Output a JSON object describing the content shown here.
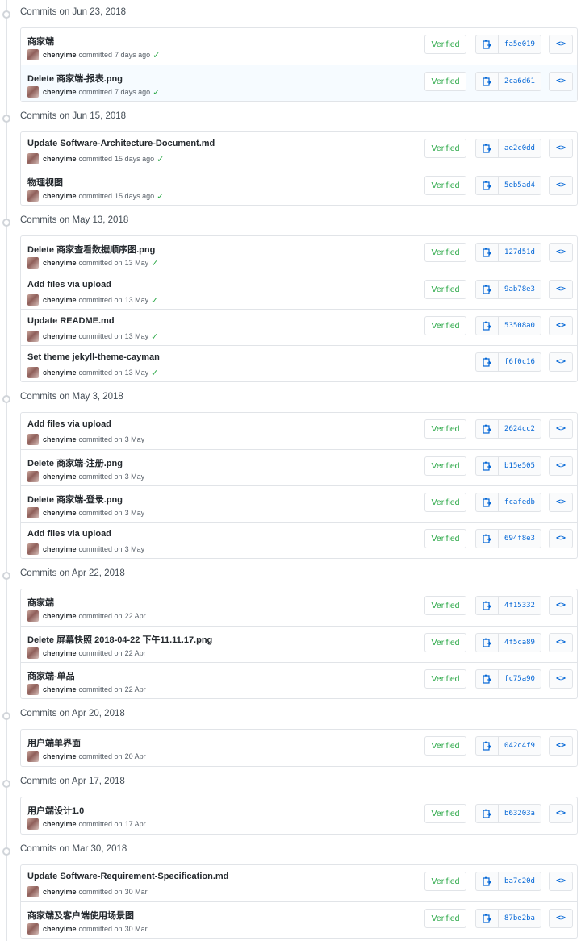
{
  "colors": {
    "verified": "#28a745",
    "sha": "#0366d6",
    "border": "#e1e4e8",
    "highlight": "#f6fbff"
  },
  "icons": {
    "copy": "clipboard-icon",
    "browse": "code-icon",
    "status": "check-icon",
    "timeline": "commit-node-icon"
  },
  "groups": [
    {
      "title": "Commits on Jun 23, 2018",
      "commits": [
        {
          "message": "商家端",
          "author": "chenyime",
          "action": "committed",
          "time": "7 days ago",
          "check": true,
          "verified": "Verified",
          "sha": "fa5e019"
        },
        {
          "message": "Delete 商家端-报表.png",
          "author": "chenyime",
          "action": "committed",
          "time": "7 days ago",
          "check": true,
          "verified": "Verified",
          "sha": "2ca6d61",
          "highlight": true
        }
      ]
    },
    {
      "title": "Commits on Jun 15, 2018",
      "commits": [
        {
          "message": "Update Software-Architecture-Document.md",
          "author": "chenyime",
          "action": "committed",
          "time": "15 days ago",
          "check": true,
          "verified": "Verified",
          "sha": "ae2c0dd"
        },
        {
          "message": "物理视图",
          "author": "chenyime",
          "action": "committed",
          "time": "15 days ago",
          "check": true,
          "verified": "Verified",
          "sha": "5eb5ad4"
        }
      ]
    },
    {
      "title": "Commits on May 13, 2018",
      "commits": [
        {
          "message": "Delete 商家查看数据顺序图.png",
          "author": "chenyime",
          "action": "committed on",
          "time": "13 May",
          "check": true,
          "verified": "Verified",
          "sha": "127d51d"
        },
        {
          "message": "Add files via upload",
          "author": "chenyime",
          "action": "committed on",
          "time": "13 May",
          "check": true,
          "verified": "Verified",
          "sha": "9ab78e3"
        },
        {
          "message": "Update README.md",
          "author": "chenyime",
          "action": "committed on",
          "time": "13 May",
          "check": true,
          "verified": "Verified",
          "sha": "53508a0"
        },
        {
          "message": "Set theme jekyll-theme-cayman",
          "author": "chenyime",
          "action": "committed on",
          "time": "13 May",
          "check": true,
          "verified": "",
          "sha": "f6f0c16"
        }
      ]
    },
    {
      "title": "Commits on May 3, 2018",
      "commits": [
        {
          "message": "Add files via upload",
          "author": "chenyime",
          "action": "committed on",
          "time": "3 May",
          "check": false,
          "verified": "Verified",
          "sha": "2624cc2"
        },
        {
          "message": "Delete 商家端-注册.png",
          "author": "chenyime",
          "action": "committed on",
          "time": "3 May",
          "check": false,
          "verified": "Verified",
          "sha": "b15e505"
        },
        {
          "message": "Delete 商家端-登录.png",
          "author": "chenyime",
          "action": "committed on",
          "time": "3 May",
          "check": false,
          "verified": "Verified",
          "sha": "fcafedb"
        },
        {
          "message": "Add files via upload",
          "author": "chenyime",
          "action": "committed on",
          "time": "3 May",
          "check": false,
          "verified": "Verified",
          "sha": "694f8e3"
        }
      ]
    },
    {
      "title": "Commits on Apr 22, 2018",
      "commits": [
        {
          "message": "商家端",
          "author": "chenyime",
          "action": "committed on",
          "time": "22 Apr",
          "check": false,
          "verified": "Verified",
          "sha": "4f15332"
        },
        {
          "message": "Delete 屏幕快照 2018-04-22 下午11.11.17.png",
          "author": "chenyime",
          "action": "committed on",
          "time": "22 Apr",
          "check": false,
          "verified": "Verified",
          "sha": "4f5ca89"
        },
        {
          "message": "商家端-单品",
          "author": "chenyime",
          "action": "committed on",
          "time": "22 Apr",
          "check": false,
          "verified": "Verified",
          "sha": "fc75a90"
        }
      ]
    },
    {
      "title": "Commits on Apr 20, 2018",
      "commits": [
        {
          "message": "用户端单界面",
          "author": "chenyime",
          "action": "committed on",
          "time": "20 Apr",
          "check": false,
          "verified": "Verified",
          "sha": "042c4f9"
        }
      ]
    },
    {
      "title": "Commits on Apr 17, 2018",
      "commits": [
        {
          "message": "用户端设计1.0",
          "author": "chenyime",
          "action": "committed on",
          "time": "17 Apr",
          "check": false,
          "verified": "Verified",
          "sha": "b63203a"
        }
      ]
    },
    {
      "title": "Commits on Mar 30, 2018",
      "commits": [
        {
          "message": "Update Software-Requirement-Specification.md",
          "author": "chenyime",
          "action": "committed on",
          "time": "30 Mar",
          "check": false,
          "verified": "Verified",
          "sha": "ba7c20d"
        },
        {
          "message": "商家端及客户端使用场景图",
          "author": "chenyime",
          "action": "committed on",
          "time": "30 Mar",
          "check": false,
          "verified": "Verified",
          "sha": "87be2ba"
        }
      ]
    }
  ]
}
